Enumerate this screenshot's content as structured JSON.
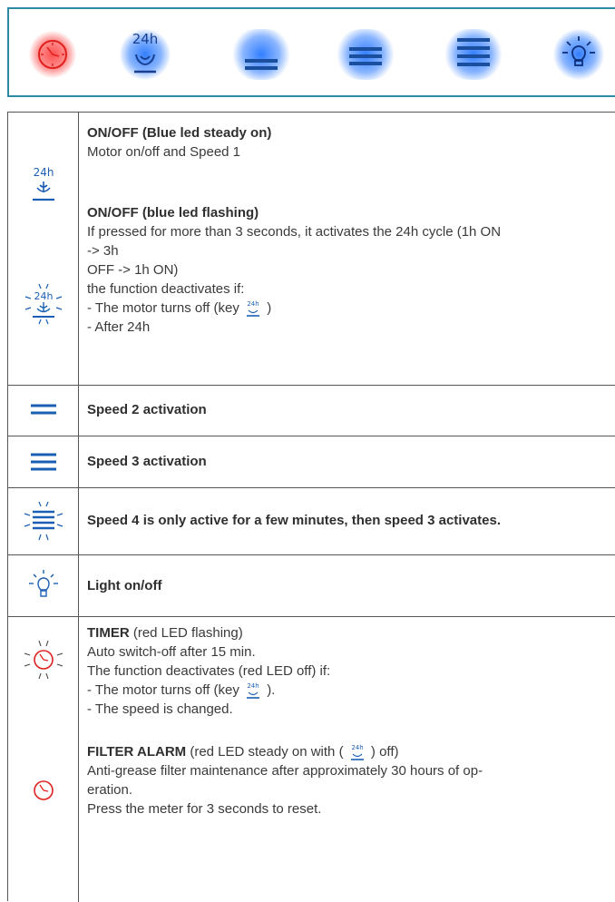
{
  "panel": {
    "buttons": [
      {
        "name": "timer",
        "glow": "#ff5050"
      },
      {
        "name": "onoff-24h",
        "label": "24h",
        "glow": "#2f7bff"
      },
      {
        "name": "speed-2",
        "glow": "#2f7bff"
      },
      {
        "name": "speed-3",
        "glow": "#2f7bff"
      },
      {
        "name": "speed-4",
        "glow": "#2f7bff"
      },
      {
        "name": "light",
        "glow": "#2f7bff"
      }
    ],
    "border_color": "#2f8aa6"
  },
  "icon_color": "#1a5fb4",
  "icon_small_label": "24h",
  "rows": {
    "onoff": {
      "title1": "ON/OFF (Blue led steady on)",
      "text1": "Motor on/off and Speed 1",
      "title2": "ON/OFF (blue led flashing)",
      "l1": "If pressed for more than 3 seconds, it activates the 24h cycle (1h ON",
      "l2": "-> 3h",
      "l3": "OFF -> 1h ON)",
      "l4": "the function deactivates if:",
      "l5a": "- The motor turns off (key",
      "l5b": ")",
      "l6": "- After 24h"
    },
    "speed2": "Speed 2 activation",
    "speed3": "Speed 3 activation",
    "speed4": "Speed 4 is only active for a few minutes, then speed 3 activates.",
    "light": "Light on/off",
    "timer": {
      "title": "TIMER",
      "title_rest": " (red LED flashing)",
      "l1": "Auto switch-off after 15 min.",
      "l2": "The function deactivates (red LED off) if:",
      "l3a": "- The motor turns off (key",
      "l3b": ").",
      "l4": "- The speed is changed.",
      "alarm_title": "FILTER ALARM",
      "alarm_rest_a": " (red LED steady on with (",
      "alarm_rest_b": ") off)",
      "l5": "Anti-grease filter maintenance after approximately 30 hours of op-",
      "l6": "eration.",
      "l7": "Press the meter for 3 seconds to reset."
    }
  }
}
